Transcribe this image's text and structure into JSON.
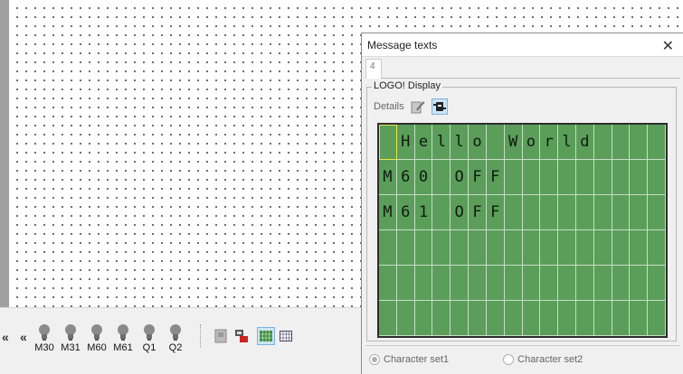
{
  "dialog": {
    "title": "Message texts",
    "tab_number": "4",
    "group_label": "LOGO! Display",
    "details_label": "Details",
    "charset1_label": "Character set1",
    "charset2_label": "Character set2",
    "charset_selected": "Character set1"
  },
  "lcd": {
    "columns": 16,
    "rows": 6,
    "lines": [
      " Hello World    ",
      "M60 OFF         ",
      "M61 OFF         ",
      "                ",
      "                ",
      "                "
    ],
    "background_color": "#5a9e5a"
  },
  "io_bar": {
    "collapse_left": "«",
    "collapse_left2": "«",
    "items": [
      "M30",
      "M31",
      "M60",
      "M61",
      "Q1",
      "Q2"
    ]
  },
  "icons": {
    "close": "close-icon",
    "bulb": "lamp-icon",
    "edit": "edit-pencil-icon",
    "display_mode": "display-mode-icon",
    "grid_view": "grid-view-icon"
  }
}
